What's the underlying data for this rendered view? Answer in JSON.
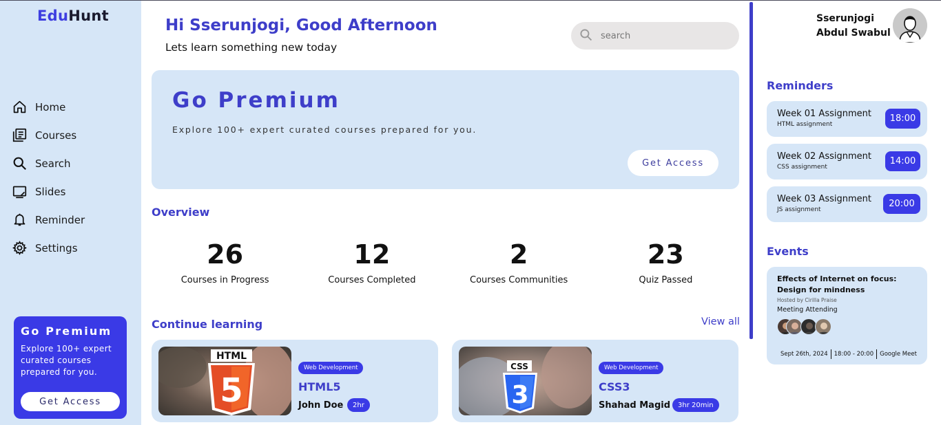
{
  "brand": {
    "part1": "Edu",
    "part2": "Hunt"
  },
  "nav": [
    {
      "label": "Home",
      "icon": "home-icon"
    },
    {
      "label": "Courses",
      "icon": "courses-icon"
    },
    {
      "label": "Search",
      "icon": "search-icon"
    },
    {
      "label": "Slides",
      "icon": "slides-icon"
    },
    {
      "label": "Reminder",
      "icon": "bell-icon"
    },
    {
      "label": "Settings",
      "icon": "gear-icon"
    }
  ],
  "sidebar_promo": {
    "title": "Go Premium",
    "text": "Explore 100+ expert curated courses prepared for you.",
    "button": "Get Access"
  },
  "header": {
    "greeting": "Hi Sserunjogi, Good Afternoon",
    "subtitle": "Lets learn something new today",
    "search_placeholder": "search"
  },
  "banner": {
    "title": "Go Premium",
    "text": "Explore 100+ expert curated courses prepared for you.",
    "button": "Get Access"
  },
  "overview": {
    "title": "Overview",
    "stats": [
      {
        "value": "26",
        "label": "Courses in Progress"
      },
      {
        "value": "12",
        "label": "Courses Completed"
      },
      {
        "value": "2",
        "label": "Courses Communities"
      },
      {
        "value": "23",
        "label": "Quiz Passed"
      }
    ]
  },
  "continue": {
    "title": "Continue learning",
    "view_all": "View all",
    "courses": [
      {
        "tag": "Web Development",
        "title": "HTML5",
        "author": "John Doe",
        "duration": "2hr",
        "badge_text": "HTML",
        "badge_num": "5",
        "badge_color": "#e44d26"
      },
      {
        "tag": "Web Development",
        "title": "CSS3",
        "author": "Shahad Magid",
        "duration": "3hr 20min",
        "badge_text": "CSS",
        "badge_num": "3",
        "badge_color": "#2965f1"
      }
    ]
  },
  "user": {
    "first": "Sserunjogi",
    "last": "Abdul Swabul"
  },
  "reminders": {
    "title": "Reminders",
    "items": [
      {
        "title": "Week 01 Assignment",
        "sub": "HTML assignment",
        "time": "18:00"
      },
      {
        "title": "Week 02 Assignment",
        "sub": "CSS assignment",
        "time": "14:00"
      },
      {
        "title": "Week 03 Assignment",
        "sub": "JS assignment",
        "time": "20:00"
      }
    ]
  },
  "events": {
    "title": "Events",
    "item": {
      "title": "Effects of Internet on focus: Design for mindness",
      "host": "Hosted by Cirilla Praise",
      "status": "Meeting Attending",
      "date": "Sept 26th, 2024",
      "time": "18:00 - 20:00",
      "platform": "Google Meet"
    }
  },
  "colors": {
    "accent": "#3e3ec9",
    "panel": "#d6e6f7",
    "button": "#3a3ae6"
  }
}
